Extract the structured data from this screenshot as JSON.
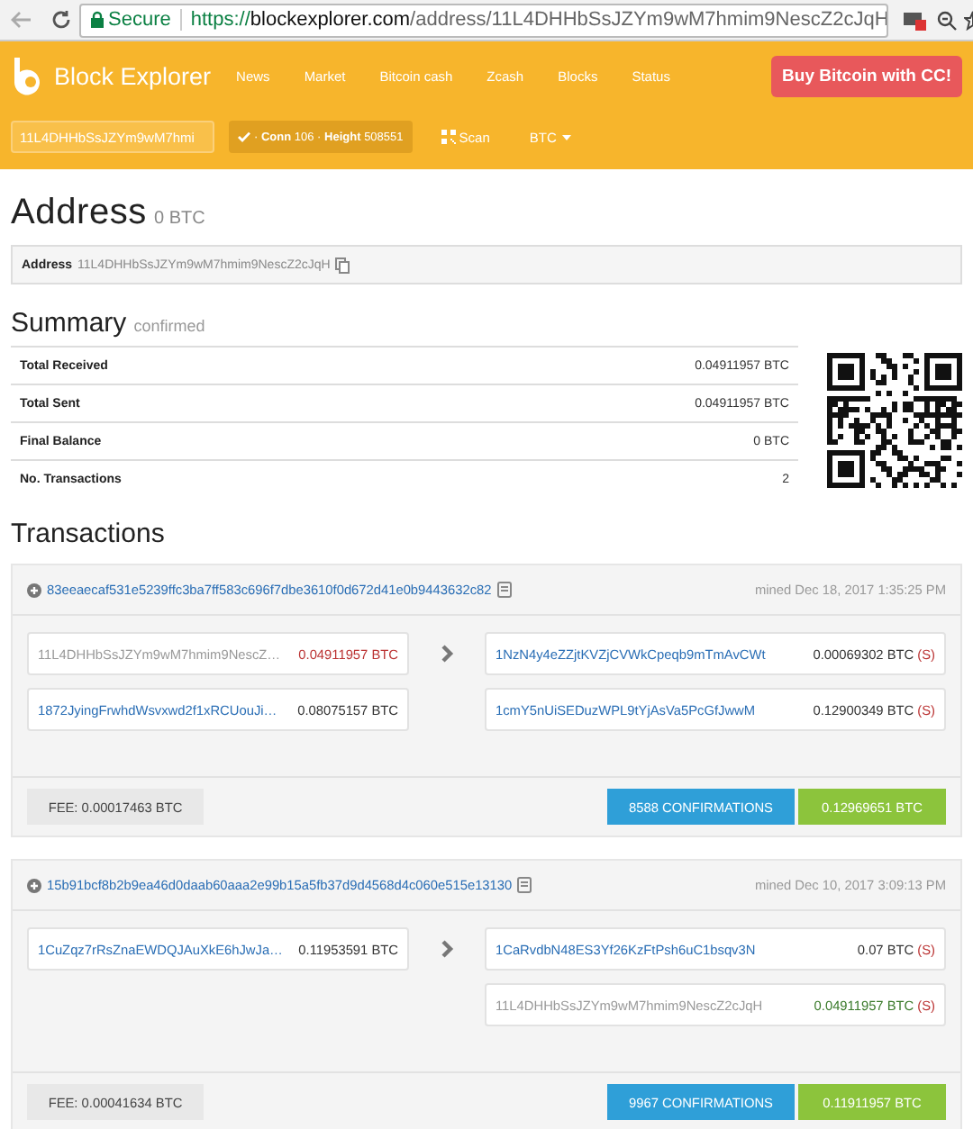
{
  "browser": {
    "secure_label": "Secure",
    "url": {
      "scheme": "https://",
      "host": "blockexplorer.com",
      "path": "/address/11L4DHHbSsJZYm9wM7hmim9NescZ2cJqH"
    }
  },
  "header": {
    "brand": "Block Explorer",
    "nav": [
      "News",
      "Market",
      "Bitcoin cash",
      "Zcash",
      "Blocks",
      "Status"
    ],
    "cta": "Buy Bitcoin with CC!",
    "search": {
      "value": "11L4DHHbSsJZYm9wM7hmi"
    },
    "status": "· **Conn** 106 · **Height** 508551",
    "scan": "Scan",
    "currency": "BTC"
  },
  "address": {
    "title": "Address",
    "balance": "0 BTC",
    "label": "Address",
    "value": "11L4DHHbSsJZYm9wM7hmim9NescZ2cJqH"
  },
  "summary": {
    "title": "Summary",
    "subtitle": "confirmed",
    "rows": [
      {
        "label": "Total Received",
        "value": "0.04911957 BTC"
      },
      {
        "label": "Total Sent",
        "value": "0.04911957 BTC"
      },
      {
        "label": "Final Balance",
        "value": "0 BTC"
      },
      {
        "label": "No. Transactions",
        "value": "2"
      }
    ]
  },
  "transactions": {
    "title": "Transactions",
    "items": [
      {
        "hash": "83eeaecaf531e5239ffc3ba7ff583c696f7dbe3610f0d672d41e0b9443632c82",
        "mined": "mined Dec 18, 2017 1:35:25 PM",
        "inputs": [
          {
            "address": "11L4DHHbSsJZYm9wM7hmim9NescZ…",
            "amount": "0.04911957 BTC",
            "self": true
          },
          {
            "address": "1872JyingFrwhdWsvxwd2f1xRCUouJi…",
            "amount": "0.08075157 BTC",
            "self": false
          }
        ],
        "outputs": [
          {
            "address": "1NzN4y4eZZjtKVZjCVWkCpeqb9mTmAvCWt",
            "amount": "0.00069302 BTC",
            "spent": "(S)",
            "self": false
          },
          {
            "address": "1cmY5nUiSEDuzWPL9tYjAsVa5PcGfJwwM",
            "amount": "0.12900349 BTC",
            "spent": "(S)",
            "self": false
          }
        ],
        "fee": "FEE: 0.00017463 BTC",
        "confirmations": "8588 CONFIRMATIONS",
        "total": "0.12969651 BTC"
      },
      {
        "hash": "15b91bcf8b2b9ea46d0daab60aaa2e99b15a5fb37d9d4568d4c060e515e13130",
        "mined": "mined Dec 10, 2017 3:09:13 PM",
        "inputs": [
          {
            "address": "1CuZqz7rRsZnaEWDQJAuXkE6hJwJa…",
            "amount": "0.11953591 BTC",
            "self": false
          }
        ],
        "outputs": [
          {
            "address": "1CaRvdbN48ES3Yf26KzFtPsh6uC1bsqv3N",
            "amount": "0.07 BTC",
            "spent": "(S)",
            "self": false
          },
          {
            "address": "11L4DHHbSsJZYm9wM7hmim9NescZ2cJqH",
            "amount": "0.04911957 BTC",
            "spent": "(S)",
            "self": true
          }
        ],
        "fee": "FEE: 0.00041634 BTC",
        "confirmations": "9967 CONFIRMATIONS",
        "total": "0.11911957 BTC"
      }
    ]
  }
}
